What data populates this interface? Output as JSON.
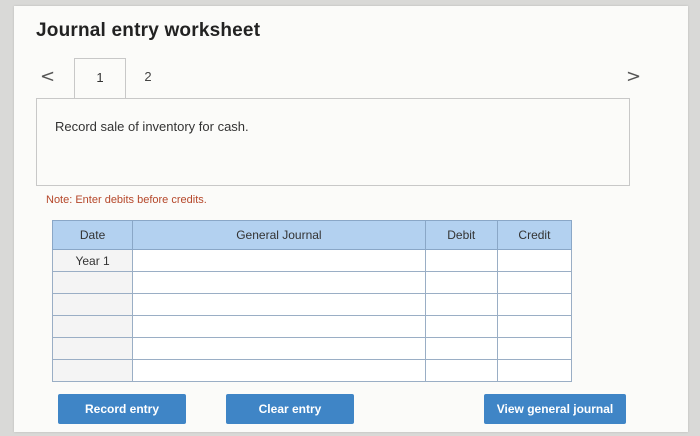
{
  "title": "Journal entry worksheet",
  "tabs": [
    {
      "label": "1"
    },
    {
      "label": "2"
    }
  ],
  "description": "Record sale of inventory for cash.",
  "note": "Note: Enter debits before credits.",
  "table": {
    "headers": [
      "Date",
      "General Journal",
      "Debit",
      "Credit"
    ],
    "rows": [
      {
        "date": "Year 1"
      },
      {
        "date": ""
      },
      {
        "date": ""
      },
      {
        "date": ""
      },
      {
        "date": ""
      },
      {
        "date": ""
      }
    ]
  },
  "buttons": {
    "record": "Record entry",
    "clear": "Clear entry",
    "view": "View general journal"
  },
  "colors": {
    "header_bg": "#b3d1f0",
    "button_bg": "#3f85c6",
    "note_text": "#b5472a"
  }
}
